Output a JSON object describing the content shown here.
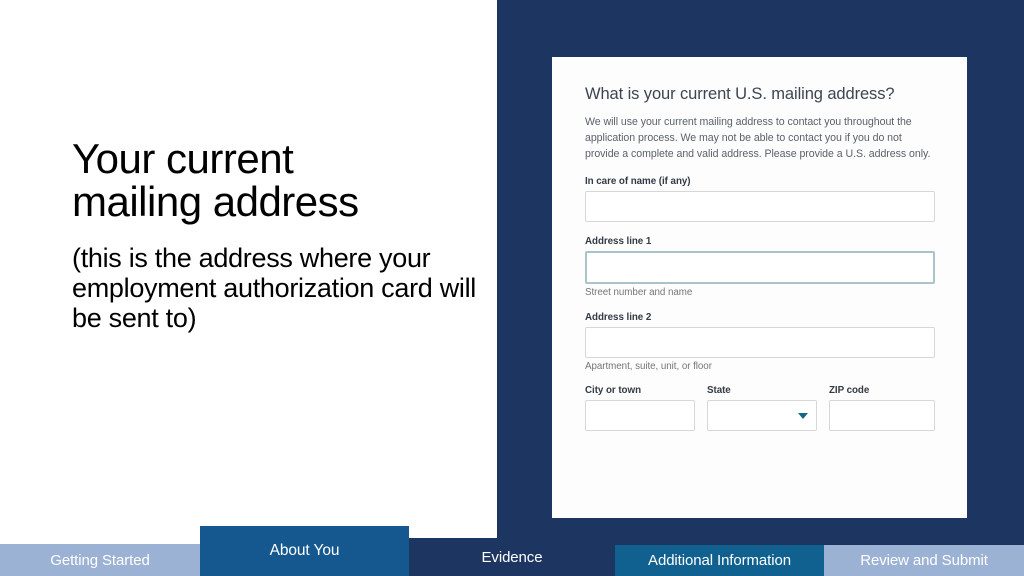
{
  "slide": {
    "background_color": "#ffffff",
    "panel_color": "#1d3661"
  },
  "left": {
    "headline": "Your current\nmailing address",
    "subline": "(this is the address where your employment authorization card will be sent to)"
  },
  "form": {
    "heading": "What is your current U.S. mailing address?",
    "intro": "We will use your current mailing address to contact you throughout the application process. We may not be able to contact you if you do not provide a complete and valid address. Please provide a U.S. address only.",
    "fields": {
      "in_care_of": {
        "label": "In care of name (if any)",
        "value": "",
        "placeholder": ""
      },
      "address_line_1": {
        "label": "Address line 1",
        "value": "",
        "placeholder": "",
        "hint": "Street number and name",
        "focused": true
      },
      "address_line_2": {
        "label": "Address line 2",
        "value": "",
        "placeholder": "",
        "hint": "Apartment, suite, unit, or floor"
      },
      "city": {
        "label": "City or town",
        "value": "",
        "placeholder": ""
      },
      "state": {
        "label": "State",
        "value": "",
        "caret_icon": "chevron-down-icon",
        "caret_color": "#14678a"
      },
      "zip": {
        "label": "ZIP code",
        "value": "",
        "placeholder": ""
      }
    }
  },
  "bottom_nav": {
    "steps": [
      {
        "label": "Getting Started",
        "color": "#9cb2d4",
        "state": "completed"
      },
      {
        "label": "About You",
        "color": "#15578f",
        "state": "current"
      },
      {
        "label": "Evidence",
        "color": "#1d3661",
        "state": "upcoming"
      },
      {
        "label": "Additional Information",
        "color": "#10618f",
        "state": "upcoming"
      },
      {
        "label": "Review and Submit",
        "color": "#9cb2d4",
        "state": "upcoming"
      }
    ]
  }
}
